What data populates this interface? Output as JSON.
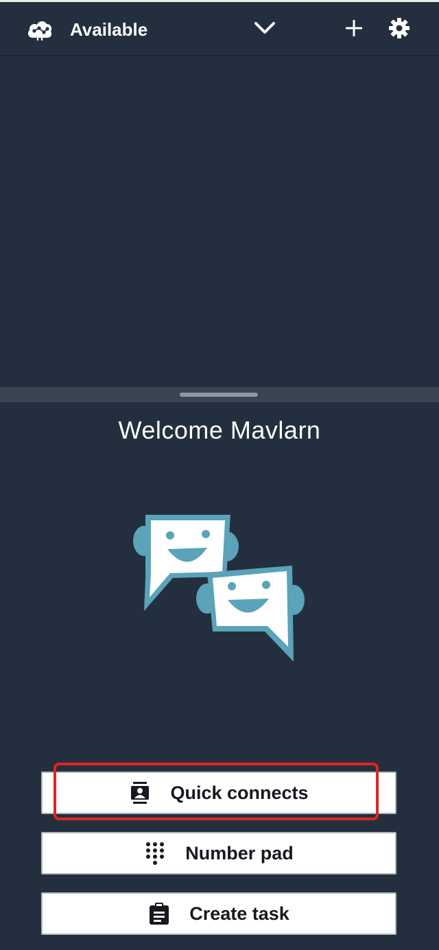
{
  "header": {
    "status_icon": "cloud-network-icon",
    "status_label": "Available",
    "status_dropdown_icon": "chevron-down-icon",
    "add_icon": "plus-icon",
    "settings_icon": "gear-icon"
  },
  "welcome": {
    "text": "Welcome Mavlarn",
    "illustration": "chat-bubbles-illustration"
  },
  "actions": {
    "quick_connects": {
      "label": "Quick connects",
      "icon": "contact-card-icon"
    },
    "number_pad": {
      "label": "Number pad",
      "icon": "dialpad-icon"
    },
    "create_task": {
      "label": "Create task",
      "icon": "clipboard-icon"
    }
  },
  "colors": {
    "background": "#232f3e",
    "divider": "#3a4552",
    "accent_teal": "#5aa3b8",
    "button_bg": "#ffffff",
    "highlight": "#e22323"
  }
}
